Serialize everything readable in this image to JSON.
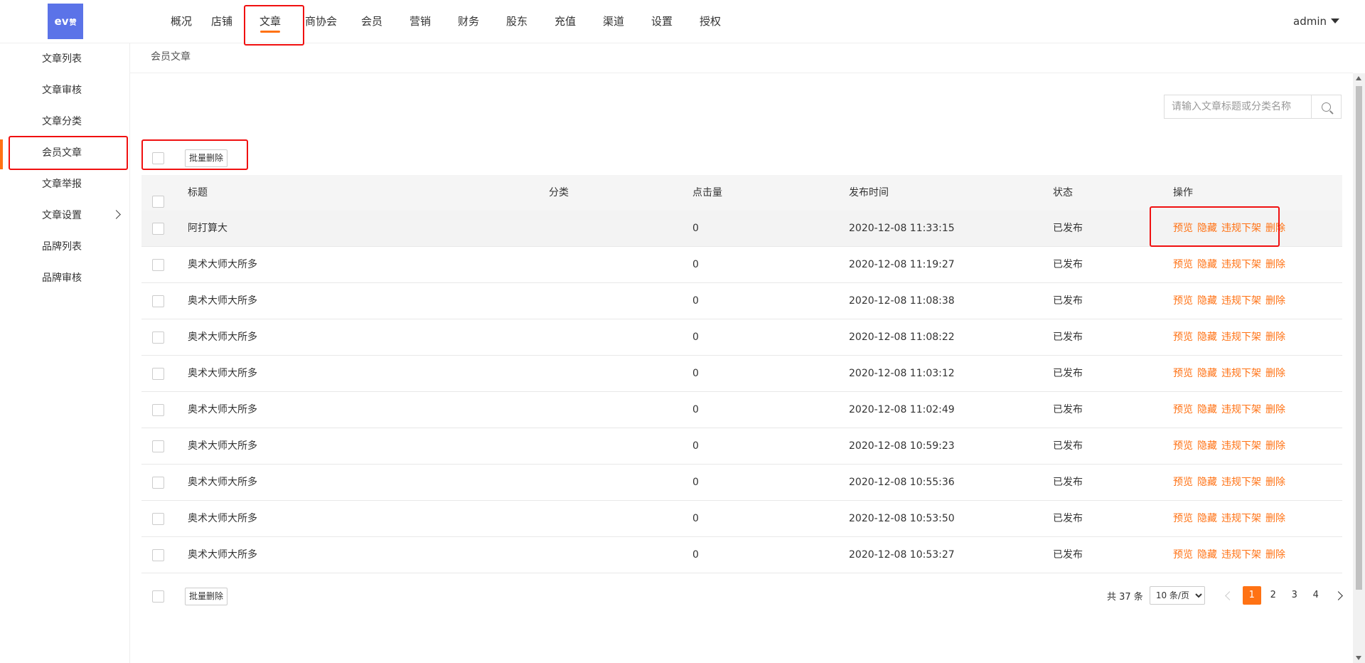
{
  "header": {
    "logo_text": "ev",
    "logo_sub": "赞",
    "nav": [
      "概况",
      "店铺",
      "文章",
      "商协会",
      "会员",
      "营销",
      "财务",
      "股东",
      "充值",
      "渠道",
      "设置",
      "授权"
    ],
    "active_nav": "文章",
    "user": "admin"
  },
  "sidebar": {
    "items": [
      "文章列表",
      "文章审核",
      "文章分类",
      "会员文章",
      "文章举报",
      "文章设置",
      "品牌列表",
      "品牌审核"
    ],
    "active": "会员文章"
  },
  "breadcrumb": "会员文章",
  "search": {
    "placeholder": "请输入文章标题或分类名称"
  },
  "batch_delete": "批量删除",
  "table": {
    "columns": [
      "标题",
      "分类",
      "点击量",
      "发布时间",
      "状态",
      "操作"
    ],
    "ops": [
      "预览",
      "隐藏",
      "违规下架",
      "删除"
    ],
    "rows": [
      {
        "title": "阿打算大",
        "category": "",
        "clicks": "0",
        "time": "2020-12-08 11:33:15",
        "status": "已发布"
      },
      {
        "title": "奥术大师大所多",
        "category": "",
        "clicks": "0",
        "time": "2020-12-08 11:19:27",
        "status": "已发布"
      },
      {
        "title": "奥术大师大所多",
        "category": "",
        "clicks": "0",
        "time": "2020-12-08 11:08:38",
        "status": "已发布"
      },
      {
        "title": "奥术大师大所多",
        "category": "",
        "clicks": "0",
        "time": "2020-12-08 11:08:22",
        "status": "已发布"
      },
      {
        "title": "奥术大师大所多",
        "category": "",
        "clicks": "0",
        "time": "2020-12-08 11:03:12",
        "status": "已发布"
      },
      {
        "title": "奥术大师大所多",
        "category": "",
        "clicks": "0",
        "time": "2020-12-08 11:02:49",
        "status": "已发布"
      },
      {
        "title": "奥术大师大所多",
        "category": "",
        "clicks": "0",
        "time": "2020-12-08 10:59:23",
        "status": "已发布"
      },
      {
        "title": "奥术大师大所多",
        "category": "",
        "clicks": "0",
        "time": "2020-12-08 10:55:36",
        "status": "已发布"
      },
      {
        "title": "奥术大师大所多",
        "category": "",
        "clicks": "0",
        "time": "2020-12-08 10:53:50",
        "status": "已发布"
      },
      {
        "title": "奥术大师大所多",
        "category": "",
        "clicks": "0",
        "time": "2020-12-08 10:53:27",
        "status": "已发布"
      }
    ]
  },
  "pagination": {
    "total": "共 37 条",
    "page_size": "10 条/页",
    "pages": [
      "1",
      "2",
      "3",
      "4"
    ],
    "current": "1"
  },
  "colors": {
    "accent": "#ff7214",
    "logo_bg": "#5b73e8",
    "highlight": "#f01010"
  }
}
